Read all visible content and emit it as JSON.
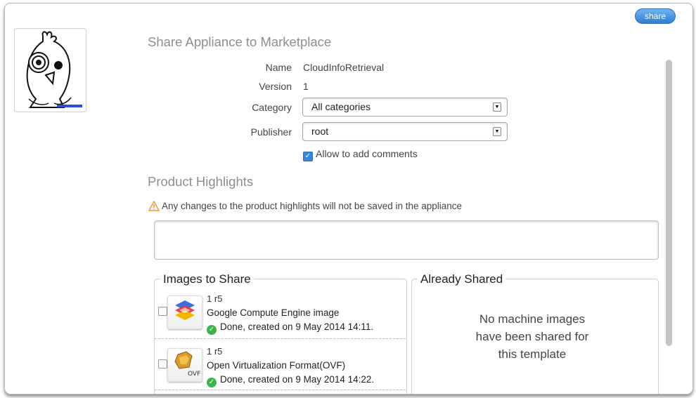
{
  "header": {
    "share_label": "share"
  },
  "form": {
    "title": "Share Appliance to Marketplace",
    "name_label": "Name",
    "name_value": "CloudInfoRetrieval",
    "version_label": "Version",
    "version_value": "1",
    "category_label": "Category",
    "category_value": "All categories",
    "publisher_label": "Publisher",
    "publisher_value": "root",
    "comments_label": "Allow to add comments",
    "comments_checked": true
  },
  "highlights": {
    "title": "Product Highlights",
    "warning": "Any changes to the product highlights will not be saved in the appliance",
    "text": ""
  },
  "images_to_share": {
    "legend": "Images to Share",
    "items": [
      {
        "version": "1 r5",
        "type": "Google Compute Engine image",
        "status": "Done, created on 9 May 2014 14:11.",
        "icon": "google-compute-engine-icon"
      },
      {
        "version": "1 r5",
        "type": "Open Virtualization Format(OVF)",
        "status": "Done, created on 9 May 2014 14:22.",
        "icon": "ovf-icon"
      }
    ]
  },
  "already_shared": {
    "legend": "Already Shared",
    "empty_message": "No machine images have been shared for this template"
  },
  "colors": {
    "accent": "#2c7ed3",
    "ok": "#3bb54a",
    "warning": "#f0a030",
    "heading": "#8e8e8e"
  }
}
